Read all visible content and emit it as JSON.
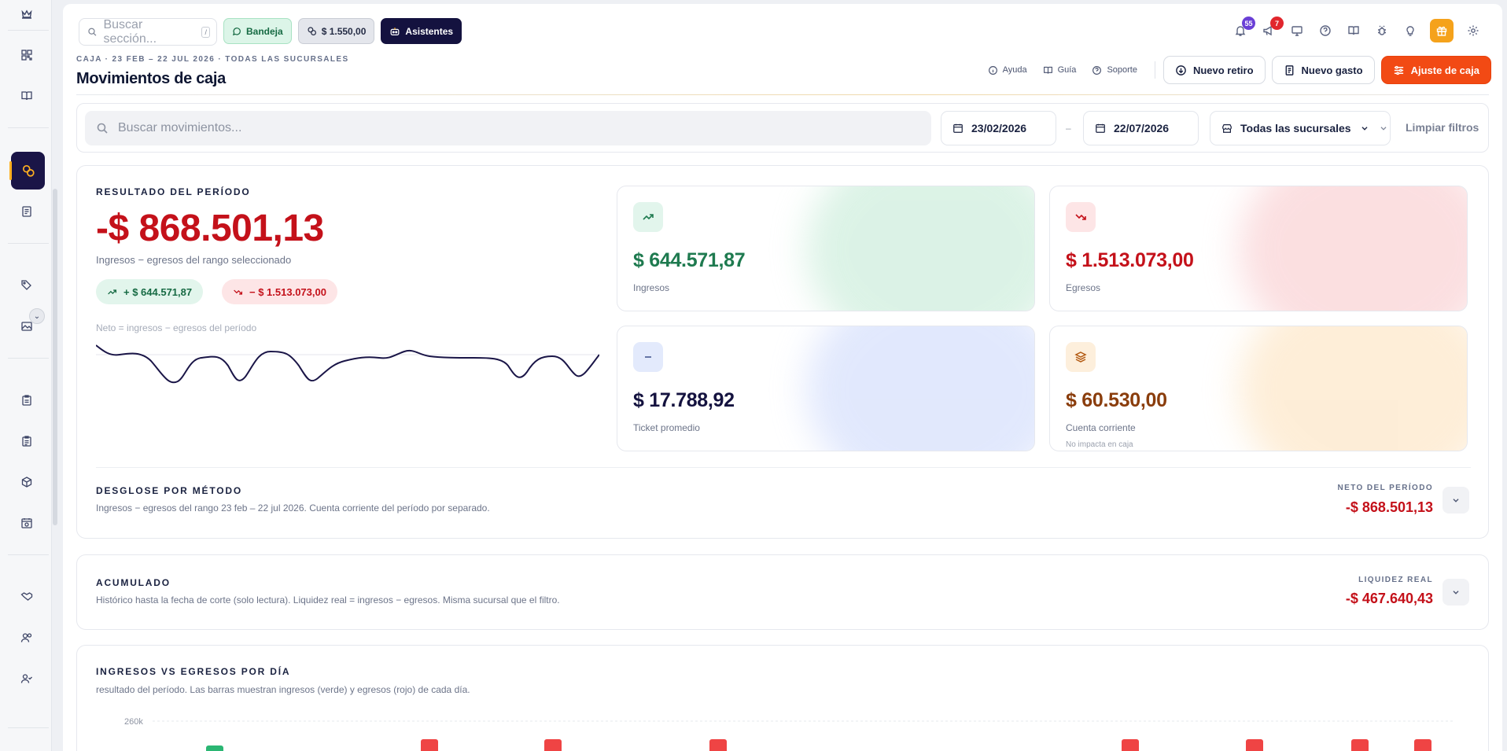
{
  "topbar": {
    "search_placeholder": "Buscar sección...",
    "search_shortcut": "/",
    "inbox_label": "Bandeja",
    "balance_label": "$ 1.550,00",
    "assistants_label": "Asistentes",
    "notifications_count": "55",
    "alerts_count": "7"
  },
  "header": {
    "breadcrumb": "CAJA · 23 FEB – 22 JUL 2026 · TODAS LAS SUCURSALES",
    "title": "Movimientos de caja",
    "help_label": "Ayuda",
    "guide_label": "Guía",
    "support_label": "Soporte",
    "new_withdrawal_label": "Nuevo retiro",
    "new_expense_label": "Nuevo gasto",
    "cash_adjust_label": "Ajuste de caja"
  },
  "filters": {
    "search_placeholder": "Buscar movimientos...",
    "date_from": "23/02/2026",
    "date_separator": "–",
    "date_to": "22/07/2026",
    "branch_label": "Todas las sucursales",
    "clear_label": "Limpiar filtros"
  },
  "result": {
    "label": "RESULTADO DEL PERÍODO",
    "value": "-$ 868.501,13",
    "subtitle": "Ingresos − egresos del rango seleccionado",
    "income_chip": "+ $ 644.571,87",
    "expense_chip": "− $ 1.513.073,00",
    "net_note": "Neto = ingresos − egresos del período"
  },
  "stats": {
    "income": {
      "value": "$ 644.571,87",
      "label": "Ingresos",
      "color": "#1e7a4f"
    },
    "expenses": {
      "value": "$ 1.513.073,00",
      "label": "Egresos",
      "color": "#c4111a"
    },
    "ticket": {
      "value": "$ 17.788,92",
      "label": "Ticket promedio",
      "color": "#14123f"
    },
    "account": {
      "value": "$ 60.530,00",
      "label": "Cuenta corriente",
      "note": "No impacta en caja",
      "color": "#8a3d0c"
    }
  },
  "breakdown": {
    "title": "DESGLOSE POR MÉTODO",
    "subtitle": "Ingresos − egresos del rango 23 feb – 22 jul 2026. Cuenta corriente del período por separado.",
    "net_label": "NETO DEL PERÍODO",
    "net_value": "-$ 868.501,13"
  },
  "accumulated": {
    "title": "ACUMULADO",
    "subtitle": "Histórico hasta la fecha de corte (solo lectura). Liquidez real = ingresos − egresos. Misma sucursal que el filtro.",
    "liquidity_label": "LIQUIDEZ REAL",
    "liquidity_value": "-$ 467.640,43"
  },
  "daily": {
    "title": "INGRESOS VS EGRESOS POR DÍA",
    "subtitle": "resultado del período. Las barras muestran ingresos (verde) y egresos (rojo) de cada día.",
    "y_tick": "260k"
  },
  "colors": {
    "accent_orange": "#f24a14",
    "navy": "#14123f",
    "negative": "#c4111a",
    "positive": "#1e7a4f"
  },
  "chart_data": {
    "type": "bar",
    "title": "INGRESOS VS EGRESOS POR DÍA",
    "series": [
      {
        "name": "ingresos (verde)",
        "values": [
          1,
          0,
          0,
          0,
          0,
          0,
          0,
          0
        ]
      },
      {
        "name": "egresos (rojo)",
        "values": [
          0,
          1,
          1,
          1,
          1,
          1,
          1,
          1
        ]
      }
    ],
    "visible_ticks": [
      "260k"
    ],
    "bar_positions": [
      0,
      1,
      2,
      3,
      4,
      5,
      6,
      7
    ]
  }
}
